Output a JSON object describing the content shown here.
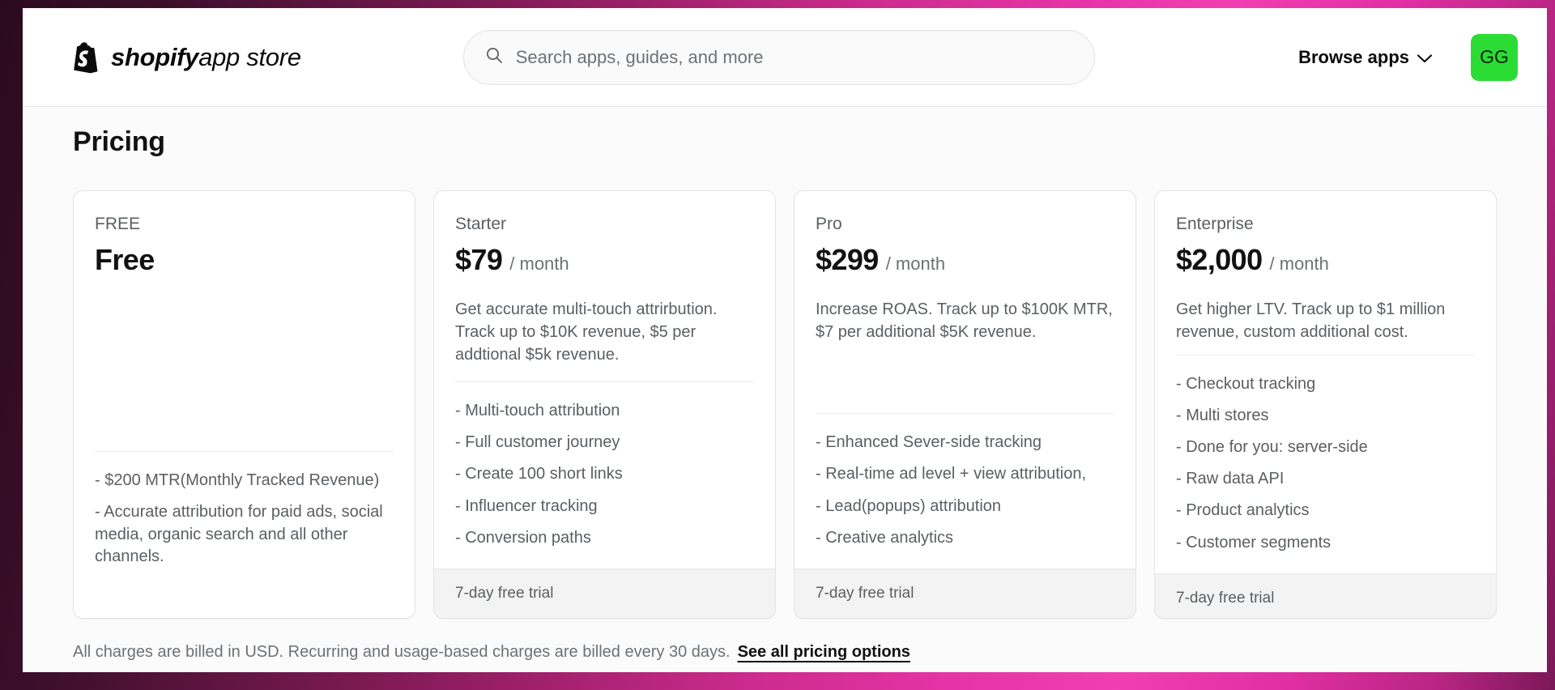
{
  "header": {
    "logo_text_bold": "shopify",
    "logo_text_light": "app store",
    "search": {
      "placeholder": "Search apps, guides, and more",
      "value": ""
    },
    "browse_label": "Browse apps",
    "avatar_initials": "GG",
    "avatar_color": "#2bdc35"
  },
  "page": {
    "title": "Pricing",
    "footnote_text": "All charges are billed in USD. Recurring and usage-based charges are billed every 30 days.",
    "footnote_link": "See all pricing options"
  },
  "plans": [
    {
      "name": "FREE",
      "price": "Free",
      "period": "",
      "description": "",
      "features": [
        "- $200 MTR(Monthly Tracked Revenue)",
        "- Accurate attribution for paid ads, social media, organic search and all other channels."
      ],
      "trial": ""
    },
    {
      "name": "Starter",
      "price": "$79",
      "period": "/ month",
      "description": "Get accurate multi-touch attrirbution. Track up to $10K revenue, $5 per addtional $5k revenue.",
      "features": [
        "- Multi-touch attribution",
        "- Full customer journey",
        "- Create 100 short links",
        "- Influencer tracking",
        "- Conversion paths"
      ],
      "trial": "7-day free trial"
    },
    {
      "name": "Pro",
      "price": "$299",
      "period": "/ month",
      "description": "Increase ROAS. Track up to $100K MTR, $7 per additional $5K revenue.",
      "features": [
        "- Enhanced Sever-side tracking",
        "- Real-time ad level + view attribution,",
        "- Lead(popups) attribution",
        "- Creative analytics"
      ],
      "trial": "7-day free trial"
    },
    {
      "name": "Enterprise",
      "price": "$2,000",
      "period": "/ month",
      "description": "Get higher LTV. Track up to $1 million revenue, custom additional cost.",
      "features": [
        "- Checkout tracking",
        "- Multi stores",
        "- Done for you: server-side",
        "- Raw data API",
        "- Product analytics",
        "- Customer segments"
      ],
      "trial": "7-day free trial"
    }
  ]
}
